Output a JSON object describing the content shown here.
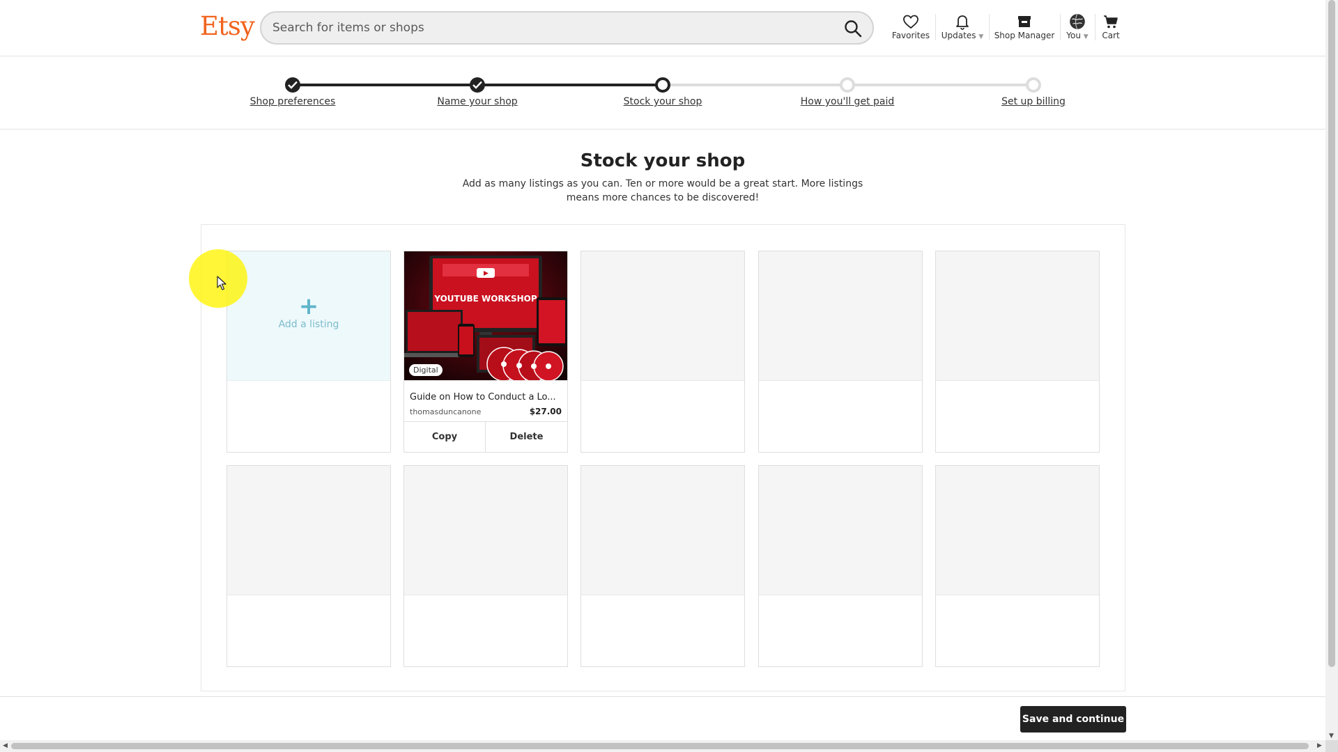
{
  "header": {
    "logo": "Etsy",
    "search_placeholder": "Search for items or shops",
    "nav": [
      {
        "label": "Favorites",
        "icon": "heart-icon"
      },
      {
        "label": "Updates",
        "icon": "bell-icon"
      },
      {
        "label": "Shop Manager",
        "icon": "shop-icon"
      },
      {
        "label": "You",
        "icon": "avatar-globe-icon"
      },
      {
        "label": "Cart",
        "icon": "cart-icon"
      }
    ]
  },
  "stepper": {
    "steps": [
      {
        "label": "Shop preferences",
        "state": "done"
      },
      {
        "label": "Name your shop",
        "state": "done"
      },
      {
        "label": "Stock your shop",
        "state": "current"
      },
      {
        "label": "How you'll get paid",
        "state": "todo"
      },
      {
        "label": "Set up billing",
        "state": "todo"
      }
    ]
  },
  "main": {
    "title": "Stock your shop",
    "subtitle": "Add as many listings as you can. Ten or more would be a great start. More listings means more chances to be discovered!"
  },
  "listings": {
    "add_label": "Add a listing",
    "items": [
      {
        "title": "Guide on How to Conduct a Lo...",
        "shop": "thomasduncanone",
        "price": "$27.00",
        "badge": "Digital",
        "image_text": "YOUTUBE WORKSHOP",
        "copy_label": "Copy",
        "delete_label": "Delete"
      }
    ],
    "empty_slots": 8
  },
  "footer": {
    "save_label": "Save and continue"
  },
  "colors": {
    "brand": "#f1641e",
    "primary_button": "#222222",
    "add_tile": "#eef9fc",
    "add_accent": "#5fb5c9"
  }
}
